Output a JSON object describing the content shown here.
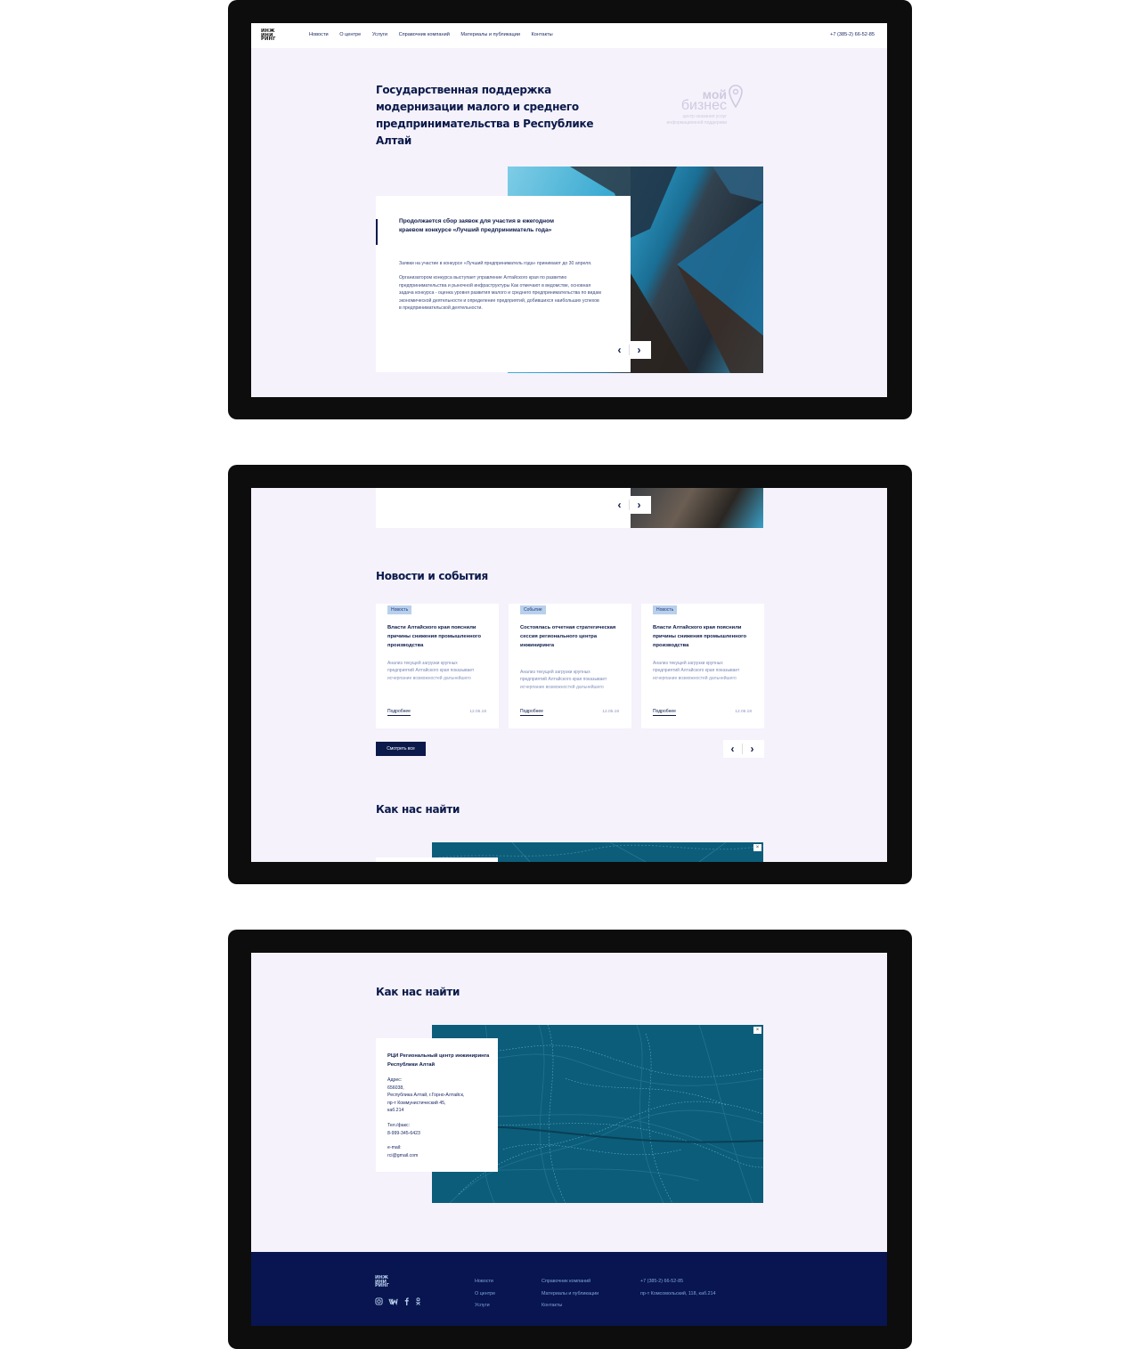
{
  "header": {
    "logo_lines": [
      "ИНЖ",
      "ИНИ",
      "РИНГ"
    ],
    "nav": [
      "Новости",
      "О центре",
      "Услуги",
      "Справочник компаний",
      "Материалы и публикации",
      "Контакты"
    ],
    "phone": "+7 (385-2) 66-52-85"
  },
  "hero": {
    "title": "Государственная поддержка модернизации малого и среднего предпринимательства в Республике Алтай",
    "brand": {
      "word1": "мой",
      "word2": "бизнес",
      "caption": "центр оказания услуг информационной поддержки"
    }
  },
  "slider": {
    "title": "Продолжается сбор заявок для участия в ежегодном краевом конкурсе «Лучший предприниматель года»",
    "paragraphs": [
      "Заявки на участие в конкурсе «Лучший предприниматель года» принимают до 30 апреля.",
      "Организатором конкурса выступает управление Алтайского края по развитию предпринимательства и рыночной инфраструктуры Как отмечают в ведомстве, основная задача конкурса - оценка уровня развития малого и среднего предпринимательства по видам экономической деятельности и определение предприятий, добившихся наибольших успехов в предпринимательской деятельности."
    ],
    "prev": "‹",
    "next": "›"
  },
  "news": {
    "title": "Новости и события",
    "items": [
      {
        "tag": "Новость",
        "title": "Власти Алтайского края пояснили причины снижения промышленного производства",
        "desc": "Анализ текущей загрузки крупных предприятий Алтайского края показывает исчерпание возможностей дальнейшего",
        "more": "Подробнее",
        "date": "12.05.18"
      },
      {
        "tag": "Событие",
        "title": "Состоялась отчетная стратегическая сессия регионального центра инжиниринга",
        "desc": "Анализ текущей загрузки крупных предприятий Алтайского края показывает исчерпание возможностей дальнейшего",
        "more": "Подробнее",
        "date": "12.05.18"
      },
      {
        "tag": "Новость",
        "title": "Власти Алтайского края пояснили причины снижения промышленного производства",
        "desc": "Анализ текущей загрузки крупных предприятий Алтайского края показывает исчерпание возможностей дальнейшего",
        "more": "Подробнее",
        "date": "12.05.18"
      }
    ],
    "all_button": "Смотреть все"
  },
  "contacts": {
    "title": "Как нас найти",
    "org": "РЦИ Региональный центр инжиниринга Республики Алтай",
    "address_label": "Адрес:",
    "address_lines": [
      "656038,",
      "Республика Алтай, г.Горно-Алтайск,",
      "пр-т Коммунистический 45,",
      "каб.214"
    ],
    "phone_label": "Тел./факс:",
    "phone": "8-999-345-6423",
    "email_label": "e-mail:",
    "email": "rci@gmail.com",
    "map_close": "×"
  },
  "footer": {
    "logo_lines": [
      "ИНЖ",
      "ИНИ",
      "РИНГ"
    ],
    "col1": [
      "Новости",
      "О центре",
      "Услуги"
    ],
    "col2": [
      "Справочник компаний",
      "Материалы и публикации",
      "Контакты"
    ],
    "col3": [
      "+7 (385-2) 66-52-85",
      "пр-т Комсомольский, 118, каб.214"
    ],
    "social_icons": [
      "instagram-icon",
      "vk-icon",
      "facebook-icon",
      "odnoklassniki-icon"
    ]
  },
  "colors": {
    "navy": "#0b1a4a",
    "bg": "#f5f2fc",
    "map": "#0c5d79",
    "footer": "#081550"
  }
}
